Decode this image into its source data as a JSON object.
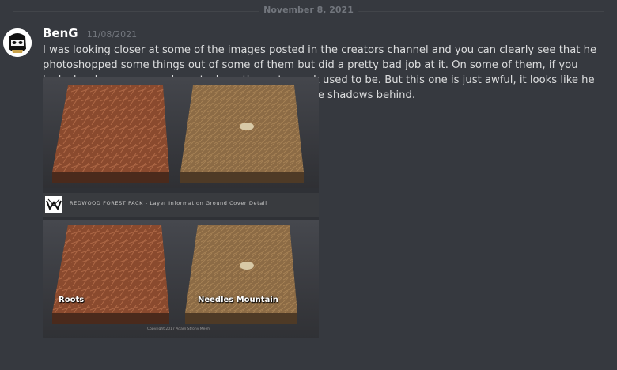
{
  "divider": {
    "date": "November 8, 2021"
  },
  "message": {
    "username": "BenG",
    "timestamp": "11/08/2021",
    "text": "I was looking closer at some of the images posted in the creators channel and you can clearly see that he photoshopped some things out of some of them but did a pretty bad job at it. On some of them, if you look closely, you can make out where the watermark used to be. But this one is just awful, it looks like he used content aware fill to remove the text but left the shadows behind."
  },
  "attachment": {
    "info_bar_text": "REDWOOD FOREST PACK - Layer Information Ground Cover Detail",
    "label_left": "Roots",
    "label_right": "Needles Mountain",
    "copyright": "Copyright 2017 Adam Strony Meeh"
  },
  "colors": {
    "background": "#36393f",
    "username": "#ffffff",
    "timestamp": "#72767d",
    "text": "#dcddde"
  }
}
